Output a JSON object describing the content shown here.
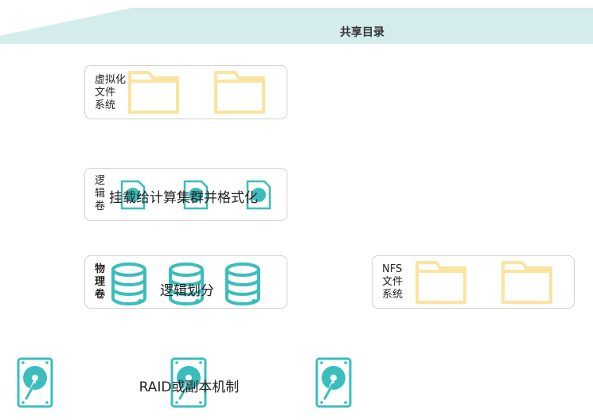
{
  "banner": {
    "title": "共享目录",
    "color": "#d4ecec"
  },
  "vfs_box": {
    "label_lines": [
      "虚拟化",
      "文件",
      "系统"
    ]
  },
  "lv_box": {
    "label_lines": [
      "逻",
      "辑",
      "卷"
    ],
    "overlay_text": "挂载给计算集群并格式化"
  },
  "pv_box": {
    "label_lines": [
      "物",
      "理",
      "卷"
    ],
    "overlay_text": "逻辑划分"
  },
  "nfs_box": {
    "label_lines": [
      "NFS",
      "文件",
      "系统"
    ]
  },
  "raid": {
    "label": "RAID或副本机制"
  },
  "colors": {
    "folder": "#fbe3a0",
    "teal": "#3bbdbd",
    "box_border": "#d0d0d0"
  }
}
